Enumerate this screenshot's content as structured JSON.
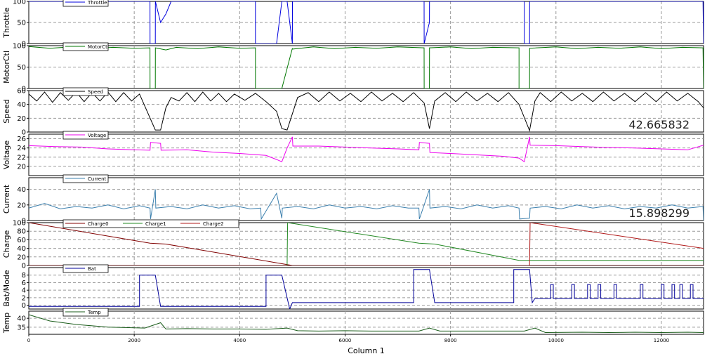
{
  "chart_data": {
    "type": "line",
    "xlabel": "Column 1",
    "xlim": [
      0,
      12800
    ],
    "x_ticks": [
      0,
      2000,
      4000,
      6000,
      8000,
      10000,
      12000
    ],
    "panels": [
      {
        "ylabel": "Throttle",
        "ylim": [
          0,
          100
        ],
        "y_ticks": [
          0,
          50,
          100
        ],
        "series": [
          {
            "name": "Throttle",
            "color": "#0000dd",
            "x": [
              0,
              1000,
              2299,
              2300,
              2400,
              2401,
              2500,
              2600,
              2700,
              2701,
              3500,
              4200,
              4299,
              4300,
              4700,
              4800,
              4900,
              5000,
              5001,
              6000,
              7400,
              7499,
              7500,
              7600,
              7601,
              7700,
              8500,
              9300,
              9399,
              9400,
              9500,
              9501,
              10000,
              11000,
              12000,
              12790,
              12800
            ],
            "y": [
              100,
              100,
              100,
              0,
              0,
              100,
              50,
              70,
              100,
              100,
              100,
              100,
              100,
              0,
              0,
              100,
              100,
              0,
              100,
              100,
              100,
              100,
              0,
              50,
              100,
              100,
              100,
              100,
              100,
              0,
              0,
              100,
              100,
              100,
              100,
              100,
              0
            ]
          }
        ]
      },
      {
        "ylabel": "MotorCtl",
        "ylim": [
          0,
          100
        ],
        "y_ticks": [
          0,
          50,
          100
        ],
        "series": [
          {
            "name": "MotorCtl",
            "color": "#007700",
            "x": [
              0,
              400,
              800,
              1200,
              1600,
              2000,
              2299,
              2300,
              2400,
              2401,
              2600,
              2800,
              3200,
              3600,
              4000,
              4299,
              4300,
              4800,
              5000,
              5001,
              5400,
              5800,
              6200,
              6600,
              7000,
              7499,
              7500,
              7600,
              7601,
              8000,
              8400,
              8800,
              9299,
              9300,
              9500,
              9501,
              10000,
              10400,
              10800,
              11200,
              11600,
              12000,
              12400,
              12790,
              12800
            ],
            "y": [
              98,
              94,
              97,
              93,
              96,
              94,
              95,
              0,
              0,
              95,
              90,
              96,
              93,
              97,
              94,
              95,
              0,
              0,
              94,
              92,
              97,
              93,
              96,
              94,
              97,
              95,
              0,
              0,
              95,
              97,
              93,
              96,
              95,
              0,
              0,
              94,
              97,
              93,
              96,
              94,
              97,
              93,
              96,
              95,
              0
            ]
          }
        ]
      },
      {
        "ylabel": "Speed",
        "ylim": [
          0,
          60
        ],
        "y_ticks": [
          0,
          20,
          40,
          60
        ],
        "readout": "42.665832",
        "series": [
          {
            "name": "Speed",
            "color": "#000000",
            "x": [
              0,
              150,
              300,
              450,
              600,
              750,
              900,
              1050,
              1200,
              1350,
              1500,
              1650,
              1800,
              1950,
              2100,
              2400,
              2500,
              2600,
              2700,
              2850,
              3000,
              3150,
              3300,
              3450,
              3600,
              3750,
              3900,
              4100,
              4300,
              4500,
              4700,
              4800,
              4900,
              5100,
              5300,
              5500,
              5700,
              5900,
              6100,
              6300,
              6500,
              6700,
              6900,
              7100,
              7300,
              7500,
              7600,
              7700,
              7900,
              8100,
              8300,
              8500,
              8700,
              8900,
              9100,
              9300,
              9500,
              9600,
              9700,
              9900,
              10100,
              10300,
              10500,
              10700,
              10900,
              11100,
              11300,
              11500,
              11700,
              11900,
              12100,
              12300,
              12500,
              12700,
              12800
            ],
            "y": [
              55,
              45,
              58,
              43,
              57,
              46,
              58,
              44,
              57,
              45,
              58,
              44,
              57,
              45,
              55,
              3,
              3,
              35,
              50,
              45,
              57,
              44,
              58,
              45,
              56,
              44,
              55,
              46,
              56,
              44,
              30,
              5,
              3,
              50,
              57,
              44,
              58,
              45,
              56,
              44,
              58,
              45,
              56,
              44,
              57,
              42,
              5,
              45,
              57,
              44,
              58,
              45,
              56,
              44,
              57,
              40,
              2,
              45,
              57,
              44,
              58,
              45,
              56,
              44,
              58,
              45,
              56,
              44,
              57,
              44,
              58,
              45,
              56,
              44,
              35
            ]
          }
        ]
      },
      {
        "ylabel": "Voltage",
        "ylim": [
          18,
          27
        ],
        "y_ticks": [
          20,
          22,
          24,
          26
        ],
        "series": [
          {
            "name": "Voltage",
            "color": "#ee00ee",
            "x": [
              0,
              500,
              1000,
              1500,
              2000,
              2300,
              2310,
              2500,
              2510,
              3000,
              3500,
              4000,
              4500,
              4700,
              4800,
              4900,
              5000,
              5010,
              5500,
              6000,
              6500,
              7000,
              7400,
              7410,
              7600,
              7610,
              8000,
              8500,
              9000,
              9300,
              9400,
              9500,
              9510,
              10000,
              10500,
              11000,
              11500,
              12000,
              12500,
              12800
            ],
            "y": [
              24.5,
              24.3,
              24.2,
              23.8,
              23.6,
              23.5,
              25.2,
              25,
              23.5,
              23.6,
              23.1,
              22.8,
              22.4,
              21.5,
              21,
              24,
              26.4,
              24.4,
              24.4,
              24.2,
              24,
              23.8,
              23.6,
              25.2,
              25,
              23,
              22.8,
              22.5,
              22.2,
              21.8,
              21,
              26.4,
              24.6,
              24.5,
              24.3,
              24.1,
              24,
              23.8,
              23.6,
              24.6
            ]
          }
        ]
      },
      {
        "ylabel": "Current",
        "ylim": [
          0,
          55
        ],
        "y_ticks": [
          0,
          20,
          40
        ],
        "readout": "15.898299",
        "series": [
          {
            "name": "Current",
            "color": "#3b7fad",
            "x": [
              0,
              300,
              600,
              900,
              1200,
              1500,
              1800,
              2100,
              2300,
              2310,
              2400,
              2410,
              2700,
              3000,
              3300,
              3600,
              3900,
              4200,
              4400,
              4410,
              4700,
              4800,
              4810,
              5100,
              5400,
              5700,
              6000,
              6300,
              6600,
              6900,
              7200,
              7400,
              7410,
              7600,
              7610,
              7900,
              8200,
              8500,
              8800,
              9100,
              9300,
              9310,
              9500,
              9510,
              9800,
              10100,
              10400,
              10700,
              11000,
              11300,
              11600,
              11900,
              12200,
              12500,
              12790,
              12800
            ],
            "y": [
              16,
              22,
              15,
              18,
              16,
              20,
              15,
              19,
              16,
              2,
              40,
              16,
              18,
              15,
              20,
              16,
              19,
              15,
              16,
              2,
              35,
              3,
              16,
              18,
              15,
              20,
              16,
              18,
              15,
              19,
              16,
              16,
              2,
              40,
              16,
              18,
              15,
              20,
              16,
              19,
              16,
              2,
              3,
              16,
              18,
              15,
              20,
              16,
              19,
              15,
              18,
              16,
              20,
              16,
              18,
              0
            ]
          }
        ]
      },
      {
        "ylabel": "Charge",
        "ylim": [
          0,
          100
        ],
        "y_ticks": [
          0,
          20,
          40,
          60,
          80,
          100
        ],
        "legend": [
          "Charge0",
          "Charge1",
          "Charge2"
        ],
        "series": [
          {
            "name": "Charge0",
            "color": "#800000",
            "x": [
              0,
              2300,
              2600,
              5000,
              5010,
              12800
            ],
            "y": [
              100,
              52,
              50,
              0,
              0,
              0
            ]
          },
          {
            "name": "Charge1",
            "color": "#228822",
            "x": [
              0,
              4900,
              4910,
              7400,
              7700,
              9300,
              9600,
              12800
            ],
            "y": [
              0,
              0,
              100,
              52,
              50,
              12,
              12,
              12
            ]
          },
          {
            "name": "Charge2",
            "color": "#b01818",
            "x": [
              0,
              9500,
              9510,
              12800
            ],
            "y": [
              0,
              0,
              100,
              40
            ]
          }
        ]
      },
      {
        "ylabel": "Bat/Mode",
        "ylim": [
          -1,
          10
        ],
        "y_ticks": [
          0,
          2,
          4,
          6,
          8
        ],
        "series": [
          {
            "name": "Bat",
            "color": "#000099",
            "x": [
              0,
              2100,
              2100,
              2400,
              2500,
              4500,
              4500,
              4800,
              4950,
              5000,
              7300,
              7300,
              7600,
              7700,
              9200,
              9200,
              9500,
              9550,
              9600,
              9900,
              9900,
              9950,
              9950,
              10300,
              10300,
              10350,
              10350,
              10600,
              10600,
              10650,
              10650,
              10800,
              10800,
              10850,
              10850,
              11100,
              11100,
              11150,
              11150,
              11600,
              11600,
              11650,
              11650,
              12000,
              12000,
              12050,
              12050,
              12200,
              12200,
              12250,
              12250,
              12350,
              12350,
              12400,
              12400,
              12550,
              12550,
              12600,
              12600,
              12800
            ],
            "y": [
              -0.3,
              -0.3,
              8,
              8,
              -0.3,
              -0.3,
              8,
              8,
              -1,
              0.7,
              0.7,
              9.5,
              9.5,
              0.7,
              0.7,
              9.5,
              9.5,
              0.7,
              1.8,
              1.8,
              5.5,
              5.5,
              1.8,
              1.8,
              5.5,
              5.5,
              1.8,
              1.8,
              5.5,
              5.5,
              1.8,
              1.8,
              5.5,
              5.5,
              1.8,
              1.8,
              5.5,
              5.5,
              1.8,
              1.8,
              5.5,
              5.5,
              1.8,
              1.8,
              5.5,
              5.5,
              1.8,
              1.8,
              5.5,
              5.5,
              1.8,
              1.8,
              5.5,
              5.5,
              1.8,
              1.8,
              5.5,
              5.5,
              1.8,
              1.8
            ]
          }
        ]
      },
      {
        "ylabel": "Temp",
        "ylim": [
          31,
          44
        ],
        "y_ticks": [
          35,
          40
        ],
        "series": [
          {
            "name": "Temp",
            "color": "#1a5c1a",
            "x": [
              0,
              400,
              900,
              1500,
              2200,
              2500,
              2600,
              3000,
              3500,
              4000,
              4500,
              4900,
              5100,
              5500,
              6000,
              6500,
              7000,
              7400,
              7600,
              7800,
              8500,
              9000,
              9400,
              9600,
              9800,
              10500,
              11000,
              11500,
              12000,
              12500,
              12800
            ],
            "y": [
              42,
              38.5,
              36.5,
              35,
              34.5,
              37.5,
              34,
              34.2,
              34,
              34,
              33.8,
              34.5,
              33,
              32.8,
              33,
              32.8,
              32.8,
              32.8,
              34.5,
              32.8,
              32.8,
              32.8,
              32.8,
              34.5,
              32,
              32.2,
              32,
              32.2,
              32,
              32.2,
              32
            ]
          }
        ]
      }
    ]
  }
}
